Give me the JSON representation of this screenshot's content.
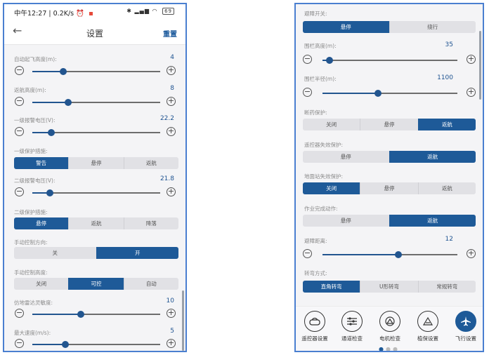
{
  "status": {
    "time": "中午12:27",
    "speed": "0.2K/s",
    "battery": "69"
  },
  "header": {
    "title": "设置",
    "reset_label": "重置"
  },
  "left": {
    "auto_takeoff_height": {
      "label": "自动起飞高度(m):",
      "value": "4",
      "fraction": 0.24
    },
    "return_height": {
      "label": "返航高度(m):",
      "value": "8",
      "fraction": 0.28
    },
    "level1_voltage": {
      "label": "一级报警电压(V):",
      "value": "22.2",
      "fraction": 0.15
    },
    "level1_protection": {
      "label": "一级保护措施:",
      "options": [
        "警告",
        "悬停",
        "返航"
      ],
      "selected": 0
    },
    "level2_voltage": {
      "label": "二级报警电压(V):",
      "value": "21.8",
      "fraction": 0.14
    },
    "level2_protection": {
      "label": "二级保护措施:",
      "options": [
        "悬停",
        "返航",
        "降落"
      ],
      "selected": 0
    },
    "manual_direction": {
      "label": "手动控制方向:",
      "options": [
        "关",
        "开"
      ],
      "selected": 1
    },
    "manual_height": {
      "label": "手动控制高度:",
      "options": [
        "关闭",
        "可控",
        "自动"
      ],
      "selected": 1
    },
    "terrain_sensitivity": {
      "label": "仿地雷达灵敏度:",
      "value": "10",
      "fraction": 0.38
    },
    "max_speed": {
      "label": "最大速度(m/s):",
      "value": "5",
      "fraction": 0.26
    }
  },
  "right": {
    "obstacle_switch": {
      "label": "避障开关:",
      "options": [
        "悬停",
        "绕行"
      ],
      "selected": 0
    },
    "fence_height": {
      "label": "围栏高度(m):",
      "value": "35",
      "fraction": 0.05
    },
    "fence_radius": {
      "label": "围栏半径(m):",
      "value": "1100",
      "fraction": 0.41
    },
    "medicine_protection": {
      "label": "断药保护:",
      "options": [
        "关闭",
        "悬停",
        "返航"
      ],
      "selected": 2
    },
    "rc_failsafe": {
      "label": "遥控器失效保护:",
      "options": [
        "悬停",
        "返航"
      ],
      "selected": 1
    },
    "gs_failsafe": {
      "label": "地面站失效保护:",
      "options": [
        "关闭",
        "悬停",
        "返航"
      ],
      "selected": 0
    },
    "job_complete": {
      "label": "作业完成动作:",
      "options": [
        "悬停",
        "返航"
      ],
      "selected": 1
    },
    "obstacle_distance": {
      "label": "避障距离:",
      "value": "12",
      "fraction": 0.56
    },
    "turn_mode": {
      "label": "转弯方式:",
      "options": [
        "直角转弯",
        "U形转弯",
        "常规转弯"
      ],
      "selected": 0
    }
  },
  "nav": {
    "items": [
      {
        "label": "遥控器设置",
        "icon": "remote-icon"
      },
      {
        "label": "通道检查",
        "icon": "sliders-icon"
      },
      {
        "label": "电机检查",
        "icon": "motor-icon"
      },
      {
        "label": "植保设置",
        "icon": "crop-icon"
      },
      {
        "label": "飞行设置",
        "icon": "airplane-icon"
      }
    ],
    "active": 4,
    "page_dots": 3,
    "page_active": 0
  },
  "colors": {
    "accent": "#1e5a98",
    "frame": "#4a7fd0"
  }
}
